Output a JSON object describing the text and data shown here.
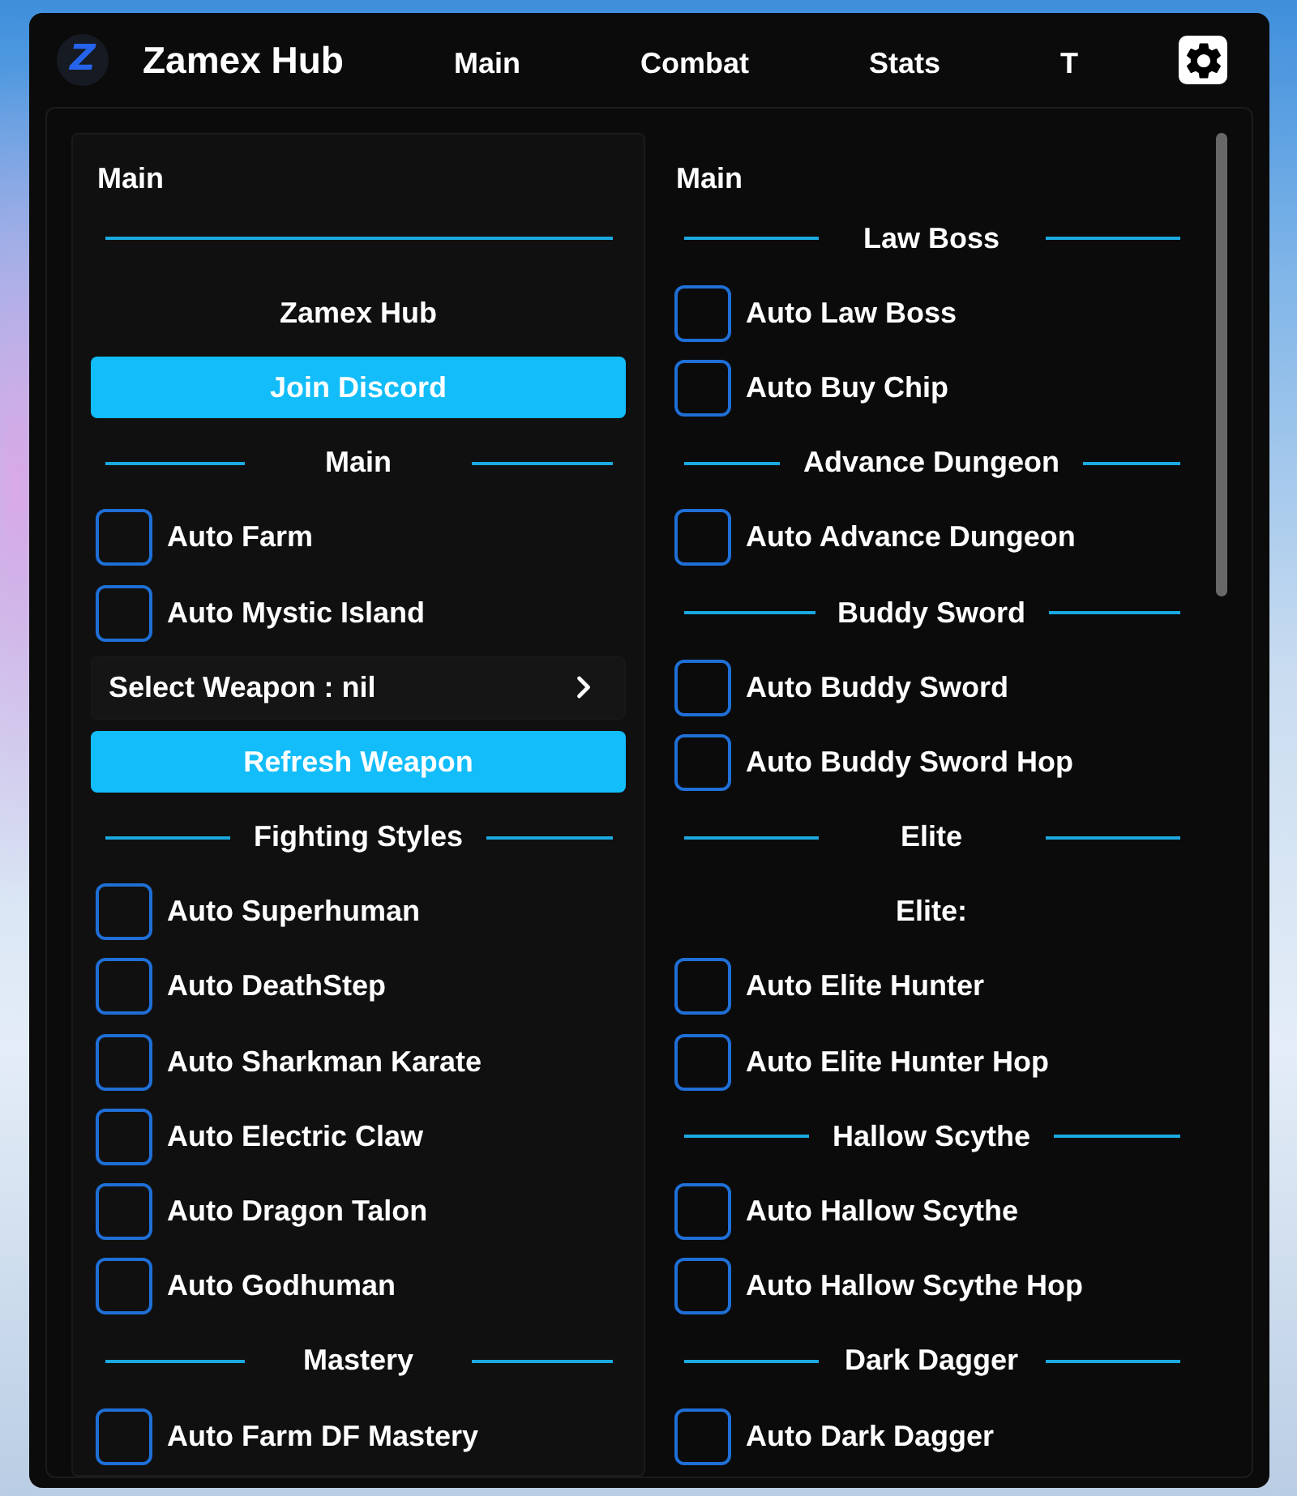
{
  "window": {
    "logo": "Z",
    "title": "Zamex Hub"
  },
  "tabs": [
    {
      "label": "Main"
    },
    {
      "label": "Combat"
    },
    {
      "label": "Stats"
    },
    {
      "label": "T"
    }
  ],
  "columns": [
    {
      "heading": "Main",
      "items": [
        {
          "kind": "divider"
        },
        {
          "kind": "label",
          "text": "Zamex Hub"
        },
        {
          "kind": "button",
          "label": "Join Discord"
        },
        {
          "kind": "section",
          "label": "Main"
        },
        {
          "kind": "toggle",
          "label": "Auto Farm",
          "checked": false
        },
        {
          "kind": "toggle",
          "label": "Auto Mystic Island",
          "checked": false
        },
        {
          "kind": "dropdown",
          "label": "Select Weapon : nil"
        },
        {
          "kind": "button",
          "label": "Refresh Weapon"
        },
        {
          "kind": "section",
          "label": "Fighting Styles"
        },
        {
          "kind": "toggle",
          "label": "Auto Superhuman",
          "checked": false
        },
        {
          "kind": "toggle",
          "label": "Auto DeathStep",
          "checked": false
        },
        {
          "kind": "toggle",
          "label": "Auto Sharkman Karate",
          "checked": false
        },
        {
          "kind": "toggle",
          "label": "Auto Electric Claw",
          "checked": false
        },
        {
          "kind": "toggle",
          "label": "Auto Dragon Talon",
          "checked": false
        },
        {
          "kind": "toggle",
          "label": "Auto Godhuman",
          "checked": false
        },
        {
          "kind": "section",
          "label": "Mastery"
        },
        {
          "kind": "toggle",
          "label": "Auto Farm DF Mastery",
          "checked": false
        }
      ]
    },
    {
      "heading": "Main",
      "items": [
        {
          "kind": "section",
          "label": "Law Boss"
        },
        {
          "kind": "toggle",
          "label": "Auto Law Boss",
          "checked": false
        },
        {
          "kind": "toggle",
          "label": "Auto Buy Chip",
          "checked": false
        },
        {
          "kind": "section",
          "label": "Advance Dungeon"
        },
        {
          "kind": "toggle",
          "label": "Auto Advance Dungeon",
          "checked": false
        },
        {
          "kind": "section",
          "label": "Buddy Sword"
        },
        {
          "kind": "toggle",
          "label": "Auto Buddy Sword",
          "checked": false
        },
        {
          "kind": "toggle",
          "label": "Auto Buddy Sword Hop",
          "checked": false
        },
        {
          "kind": "section",
          "label": "Elite"
        },
        {
          "kind": "label",
          "text": "Elite:"
        },
        {
          "kind": "toggle",
          "label": "Auto Elite Hunter",
          "checked": false
        },
        {
          "kind": "toggle",
          "label": "Auto Elite Hunter Hop",
          "checked": false
        },
        {
          "kind": "section",
          "label": "Hallow Scythe"
        },
        {
          "kind": "toggle",
          "label": "Auto Hallow Scythe",
          "checked": false
        },
        {
          "kind": "toggle",
          "label": "Auto Hallow Scythe Hop",
          "checked": false
        },
        {
          "kind": "section",
          "label": "Dark Dagger"
        },
        {
          "kind": "toggle",
          "label": "Auto Dark Dagger",
          "checked": false
        }
      ]
    }
  ]
}
